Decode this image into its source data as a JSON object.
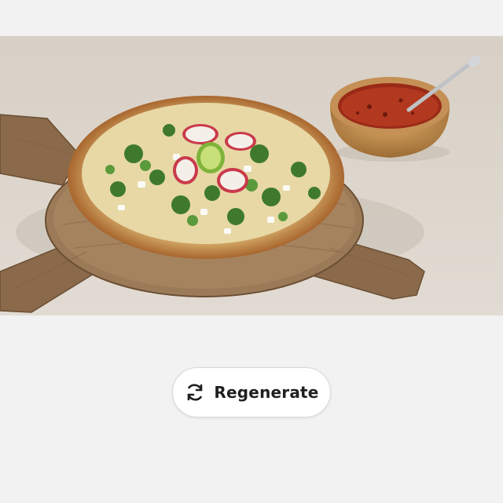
{
  "photo": {
    "subject": "pizza-on-wooden-board-with-salsa-bowl"
  },
  "regenerate_button": {
    "label": "Regenerate",
    "icon": "refresh-icon"
  },
  "colors": {
    "page_background": "#f2f2f2",
    "button_background": "#ffffff",
    "button_text": "#1f1f1f"
  }
}
